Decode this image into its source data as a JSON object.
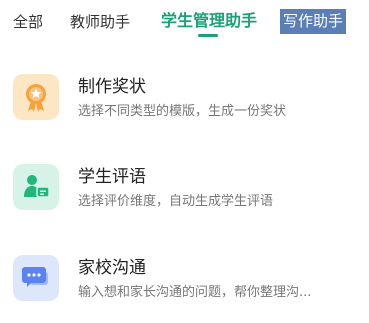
{
  "tabs": [
    {
      "label": "全部"
    },
    {
      "label": "教师助手"
    },
    {
      "label": "学生管理助手"
    },
    {
      "label": "写作助手"
    }
  ],
  "active_tab": "学生管理助手",
  "colors": {
    "active_tab": "#1aa179",
    "highlight_tab_bg": "#5b7fb5",
    "award_bg": "#fde6c4",
    "award_icon": "#f5a33a",
    "comment_bg": "#d7f3e8",
    "comment_icon": "#1fb87a",
    "chat_bg": "#dde6fb",
    "chat_icon": "#5b82f0"
  },
  "items": [
    {
      "title": "制作奖状",
      "desc": "选择不同类型的模版，生成一份奖状",
      "icon": "award-medal-icon"
    },
    {
      "title": "学生评语",
      "desc": "选择评价维度，自动生成学生评语",
      "icon": "student-card-icon"
    },
    {
      "title": "家校沟通",
      "desc": "输入想和家长沟通的问题，帮你整理沟...",
      "icon": "chat-bubble-icon"
    }
  ]
}
